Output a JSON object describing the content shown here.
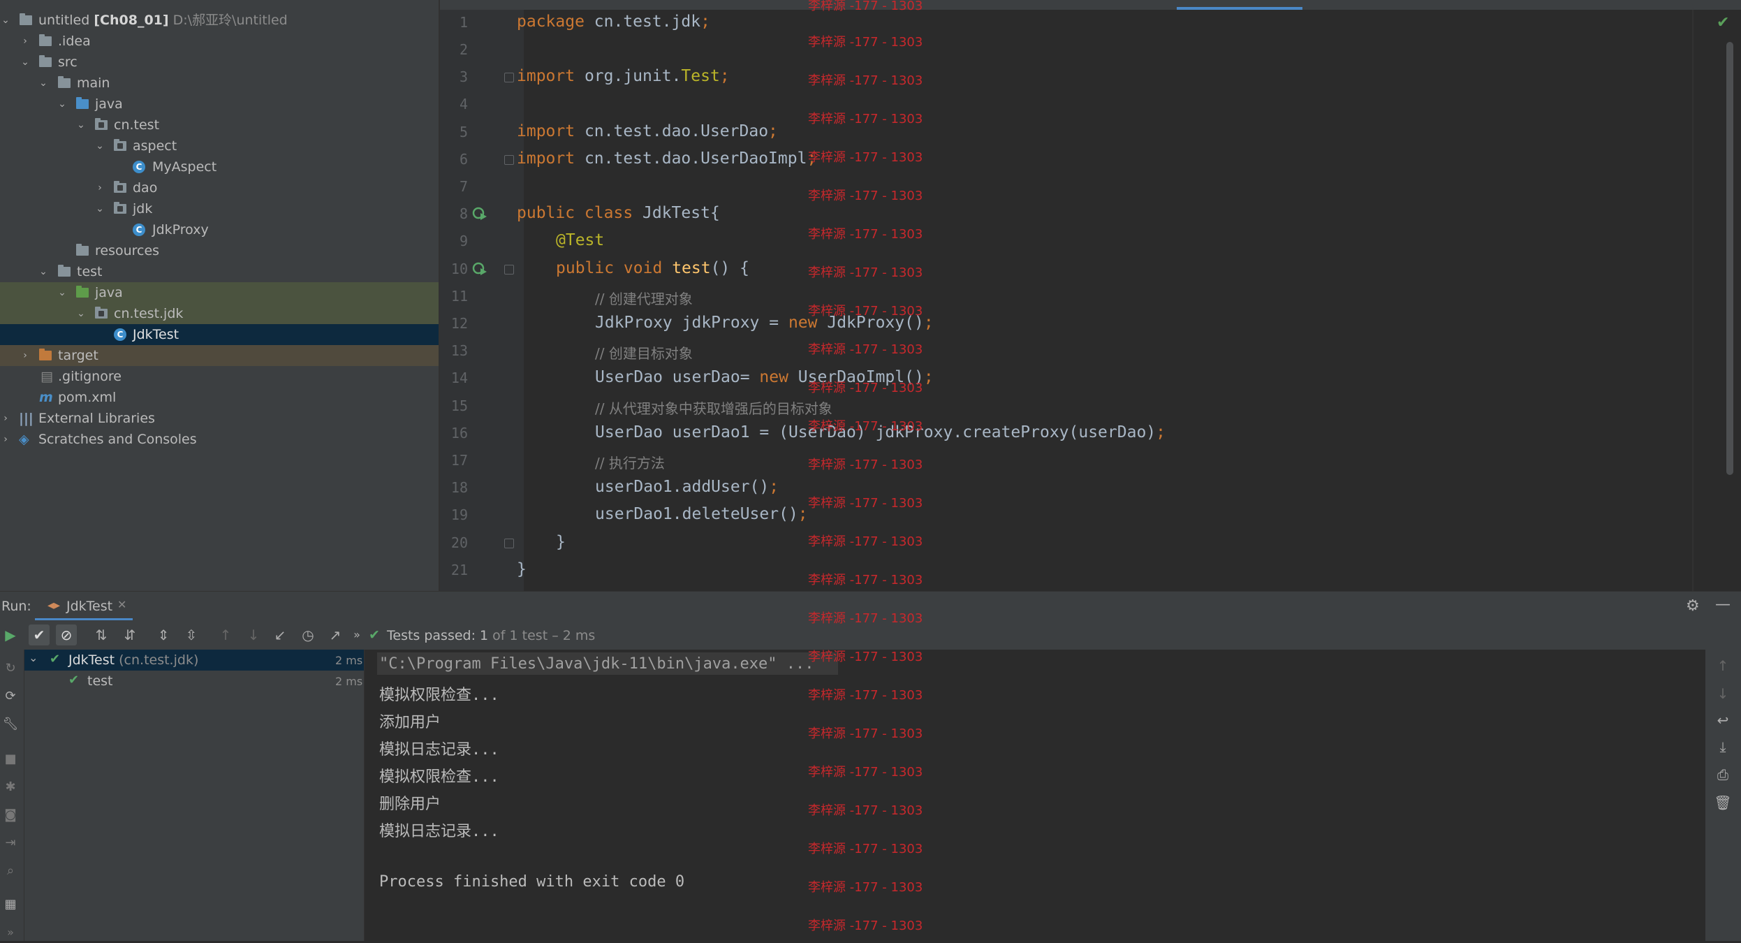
{
  "project_tree": {
    "items": [
      {
        "label": "untitled",
        "bold": "[Ch08_01]",
        "sub": "D:\\郝亚玲\\untitled"
      },
      {
        "label": ".idea"
      },
      {
        "label": "src"
      },
      {
        "label": "main"
      },
      {
        "label": "java"
      },
      {
        "label": "cn.test"
      },
      {
        "label": "aspect"
      },
      {
        "label": "MyAspect"
      },
      {
        "label": "dao"
      },
      {
        "label": "jdk"
      },
      {
        "label": "JdkProxy"
      },
      {
        "label": "resources"
      },
      {
        "label": "test"
      },
      {
        "label": "java"
      },
      {
        "label": "cn.test.jdk"
      },
      {
        "label": "JdkTest"
      },
      {
        "label": "target"
      },
      {
        "label": ".gitignore"
      },
      {
        "label": "pom.xml"
      },
      {
        "label": "External Libraries"
      },
      {
        "label": "Scratches and Consoles"
      }
    ]
  },
  "editor": {
    "line_numbers": [
      "1",
      "2",
      "3",
      "4",
      "5",
      "6",
      "7",
      "8",
      "9",
      "10",
      "11",
      "12",
      "13",
      "14",
      "15",
      "16",
      "17",
      "18",
      "19",
      "20",
      "21"
    ],
    "lines": {
      "l1a": "package",
      "l1b": " cn.test.jdk",
      "l3a": "import",
      "l3b": " org.junit.",
      "l3c": "Test",
      "l5a": "import",
      "l5b": " cn.test.dao.UserDao",
      "l6a": "import",
      "l6b": " cn.test.dao.UserDaoImpl",
      "l8a": "public class",
      "l8b": " JdkTest{",
      "l9": "@Test",
      "l10a": "public void",
      "l10b": "test",
      "l10c": "() {",
      "l11": "// 创建代理对象",
      "l12a": "JdkProxy jdkProxy = ",
      "l12b": "new",
      "l12c": " JdkProxy()",
      "l13": "// 创建目标对象",
      "l14a": "UserDao userDao= ",
      "l14b": "new",
      "l14c": " UserDaoImpl()",
      "l15": "// 从代理对象中获取增强后的目标对象",
      "l16": "UserDao userDao1 = (UserDao) jdkProxy.createProxy(userDao)",
      "l17": "// 执行方法",
      "l18": "userDao1.addUser()",
      "l19": "userDao1.deleteUser()",
      "l20": "}",
      "l21": "}",
      "semi": ";"
    },
    "watermark": "李梓源 -177 - 1303"
  },
  "run": {
    "panel_label": "Run:",
    "tab_label": "JdkTest",
    "status_passed": "Tests passed: ",
    "status_count": "1",
    "status_rest": " of 1 test – 2 ms",
    "tree": [
      {
        "label": "JdkTest",
        "sub": " (cn.test.jdk)",
        "time": "2 ms"
      },
      {
        "label": "test",
        "time": "2 ms"
      }
    ],
    "console": [
      "\"C:\\Program Files\\Java\\jdk-11\\bin\\java.exe\" ...",
      "模拟权限检查...",
      "添加用户",
      "模拟日志记录...",
      "模拟权限检查...",
      "删除用户",
      "模拟日志记录...",
      "",
      "Process finished with exit code 0"
    ]
  }
}
